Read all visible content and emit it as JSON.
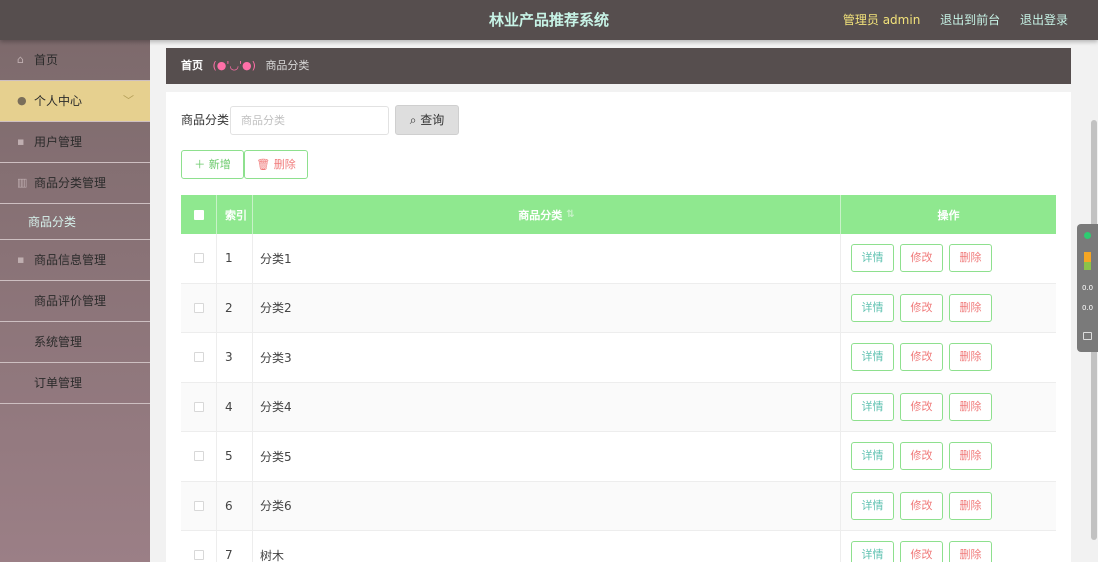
{
  "header": {
    "title": "林业产品推荐系统",
    "admin": "管理员 admin",
    "to_front": "退出到前台",
    "logout": "退出登录"
  },
  "sidebar": {
    "items": [
      {
        "label": "首页",
        "icon": "home-icon"
      },
      {
        "label": "个人中心",
        "icon": "user-icon",
        "active": true
      },
      {
        "label": "用户管理",
        "icon": "users-icon"
      },
      {
        "label": "商品分类管理",
        "icon": "category-icon"
      },
      {
        "label": "商品信息管理",
        "icon": "goods-icon"
      },
      {
        "label": "商品评价管理",
        "icon": "comment-icon"
      },
      {
        "label": "系统管理",
        "icon": "settings-icon"
      },
      {
        "label": "订单管理",
        "icon": "order-icon"
      }
    ],
    "submenu_label": "商品分类"
  },
  "breadcrumb": {
    "home": "首页",
    "face": "(●'◡'●)",
    "current": "商品分类"
  },
  "search": {
    "label": "商品分类",
    "placeholder": "商品分类",
    "button": "查询"
  },
  "actions": {
    "add": "新增",
    "delete": "删除"
  },
  "table": {
    "headers": {
      "index": "索引",
      "name": "商品分类",
      "ops": "操作"
    },
    "ops_labels": {
      "detail": "详情",
      "edit": "修改",
      "remove": "删除"
    },
    "rows": [
      {
        "index": "1",
        "name": "分类1"
      },
      {
        "index": "2",
        "name": "分类2"
      },
      {
        "index": "3",
        "name": "分类3"
      },
      {
        "index": "4",
        "name": "分类4"
      },
      {
        "index": "5",
        "name": "分类5"
      },
      {
        "index": "6",
        "name": "分类6"
      },
      {
        "index": "7",
        "name": "树木"
      }
    ]
  },
  "widget": {
    "v1": "0.0",
    "v2": "0.0"
  },
  "colors": {
    "header_bg": "#564e4e",
    "accent_green": "#8fe88f",
    "active_menu": "#e6d08f"
  }
}
